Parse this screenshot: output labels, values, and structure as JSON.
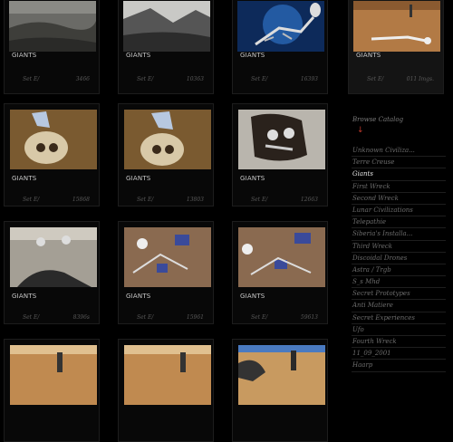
{
  "cards": [
    {
      "title": "GIANTS",
      "left": "Set E/",
      "right": "3466"
    },
    {
      "title": "GIANTS",
      "left": "Set E/",
      "right": "10363"
    },
    {
      "title": "GIANTS",
      "left": "Set E/",
      "right": "16393"
    },
    {
      "title": "GIANTS",
      "left": "Set E/",
      "right": "011 Imgs."
    },
    {
      "title": "GIANTS",
      "left": "Set E/",
      "right": "15868"
    },
    {
      "title": "GIANTS",
      "left": "Set E/",
      "right": "13803"
    },
    {
      "title": "GIANTS",
      "left": "Set E/",
      "right": "12663"
    },
    {
      "title": "GIANTS",
      "left": "Set E/",
      "right": "8396s"
    },
    {
      "title": "GIANTS",
      "left": "Set E/",
      "right": "15961"
    },
    {
      "title": "GIANTS",
      "left": "Set E/",
      "right": "59613"
    }
  ],
  "sidebar": {
    "title": "Browse Catalog",
    "arrow": "↓",
    "items": [
      "Unknown Civiliza...",
      "Terre Creuse",
      "Giants",
      "First Wreck",
      "Second Wreck",
      "Lunar Civilizations",
      "Telepathie",
      "Siberia's Installa...",
      "Third Wreck",
      "Discoidal Drones",
      "Astra / Trgb",
      "S_s Mhd",
      "Secret Prototypes",
      "Anti Matiere",
      "Secret Experiences",
      "Ufo",
      "Fourth Wreck",
      "11_09_2001",
      "Haarp"
    ],
    "active_index": 2
  }
}
